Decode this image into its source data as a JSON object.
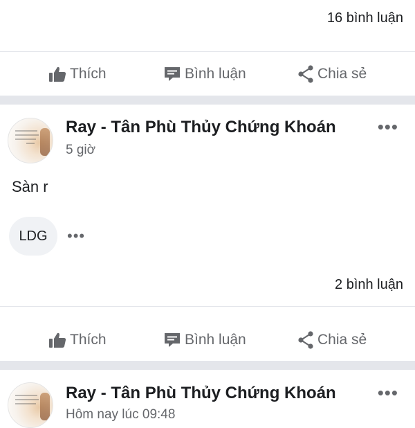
{
  "post1": {
    "comments": "16 bình luận"
  },
  "actions": {
    "like": "Thích",
    "comment": "Bình luận",
    "share": "Chia sẻ"
  },
  "post2": {
    "author": "Ray - Tân Phù Thủy Chứng Khoán",
    "time": "5 giờ",
    "text": "Sàn r",
    "tag": "LDG",
    "comments": "2 bình luận"
  },
  "post3": {
    "author": "Ray - Tân Phù Thủy Chứng Khoán",
    "time": "Hôm nay lúc 09:48"
  },
  "icons": {
    "like": "thumbs-up-icon",
    "comment": "comment-icon",
    "share": "share-icon",
    "more": "more-horizontal-icon"
  }
}
